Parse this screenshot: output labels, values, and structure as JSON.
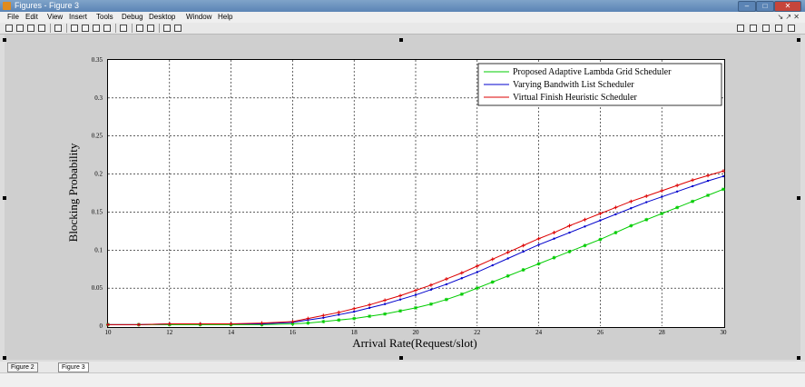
{
  "window": {
    "title": "Figures - Figure 3",
    "controls": [
      "–",
      "□",
      "✕"
    ]
  },
  "menubar": {
    "items": [
      "File",
      "Edit",
      "View",
      "Insert",
      "Tools",
      "Debug",
      "Desktop",
      "Window",
      "Help"
    ],
    "right": "↘ ↗ ✕"
  },
  "toolbar": {
    "icons": [
      "new-figure-icon",
      "open-icon",
      "save-icon",
      "print-icon",
      "arrow-icon",
      "zoom-in-icon",
      "zoom-out-icon",
      "pan-icon",
      "rotate-icon",
      "data-cursor-icon",
      "colorbar-icon",
      "legend-icon",
      "grid-icon",
      "tile-icon"
    ]
  },
  "tabs": [
    {
      "label": "Figure 2",
      "active": false
    },
    {
      "label": "Figure 3",
      "active": true
    }
  ],
  "chart_data": {
    "type": "line",
    "title": "",
    "xlabel": "Arrival Rate(Request/slot)",
    "ylabel": "Blocking Probability",
    "xlim": [
      10,
      30
    ],
    "ylim": [
      0,
      0.35
    ],
    "xticks": [
      "10",
      "12",
      "14",
      "16",
      "18",
      "20",
      "22",
      "24",
      "26",
      "28",
      "30"
    ],
    "yticks": [
      "0",
      "0.05",
      "0.1",
      "0.15",
      "0.2",
      "0.25",
      "0.3",
      "0.35"
    ],
    "grid": true,
    "legend_position": "top-right",
    "series": [
      {
        "name": "Proposed Adaptive Lambda Grid Scheduler",
        "color": "#00cc00",
        "marker": "*",
        "x": [
          10,
          11,
          12,
          13,
          14,
          15,
          16,
          16.5,
          17,
          17.5,
          18,
          18.5,
          19,
          19.5,
          20,
          20.5,
          21,
          21.5,
          22,
          22.5,
          23,
          23.5,
          24,
          24.5,
          25,
          25.5,
          26,
          26.5,
          27,
          27.5,
          28,
          28.5,
          29,
          29.5,
          30
        ],
        "values": [
          0.002,
          0.002,
          0.002,
          0.002,
          0.002,
          0.002,
          0.003,
          0.004,
          0.006,
          0.008,
          0.01,
          0.013,
          0.016,
          0.02,
          0.024,
          0.029,
          0.035,
          0.042,
          0.05,
          0.058,
          0.066,
          0.074,
          0.082,
          0.09,
          0.098,
          0.106,
          0.114,
          0.123,
          0.132,
          0.14,
          0.148,
          0.156,
          0.164,
          0.172,
          0.18
        ]
      },
      {
        "name": "Varying Bandwith List Scheduler",
        "color": "#0000cc",
        "marker": ".",
        "x": [
          10,
          11,
          12,
          13,
          14,
          15,
          16,
          16.5,
          17,
          17.5,
          18,
          18.5,
          19,
          19.5,
          20,
          20.5,
          21,
          21.5,
          22,
          22.5,
          23,
          23.5,
          24,
          24.5,
          25,
          25.5,
          26,
          26.5,
          27,
          27.5,
          28,
          28.5,
          29,
          29.5,
          30
        ],
        "values": [
          0.002,
          0.002,
          0.003,
          0.003,
          0.003,
          0.003,
          0.005,
          0.008,
          0.011,
          0.015,
          0.019,
          0.024,
          0.029,
          0.035,
          0.041,
          0.048,
          0.055,
          0.063,
          0.071,
          0.08,
          0.089,
          0.098,
          0.107,
          0.115,
          0.123,
          0.131,
          0.139,
          0.147,
          0.155,
          0.163,
          0.17,
          0.177,
          0.184,
          0.191,
          0.197
        ]
      },
      {
        "name": "Virtual Finish Heuristic Scheduler",
        "color": "#dd0000",
        "marker": "+",
        "x": [
          10,
          11,
          12,
          13,
          14,
          15,
          16,
          16.5,
          17,
          17.5,
          18,
          18.5,
          19,
          19.5,
          20,
          20.5,
          21,
          21.5,
          22,
          22.5,
          23,
          23.5,
          24,
          24.5,
          25,
          25.5,
          26,
          26.5,
          27,
          27.5,
          28,
          28.5,
          29,
          29.5,
          30
        ],
        "values": [
          0.002,
          0.002,
          0.003,
          0.003,
          0.003,
          0.004,
          0.006,
          0.01,
          0.014,
          0.018,
          0.023,
          0.028,
          0.034,
          0.04,
          0.047,
          0.054,
          0.062,
          0.07,
          0.079,
          0.088,
          0.097,
          0.106,
          0.115,
          0.123,
          0.132,
          0.14,
          0.148,
          0.156,
          0.164,
          0.171,
          0.178,
          0.185,
          0.192,
          0.198,
          0.204
        ]
      }
    ]
  }
}
